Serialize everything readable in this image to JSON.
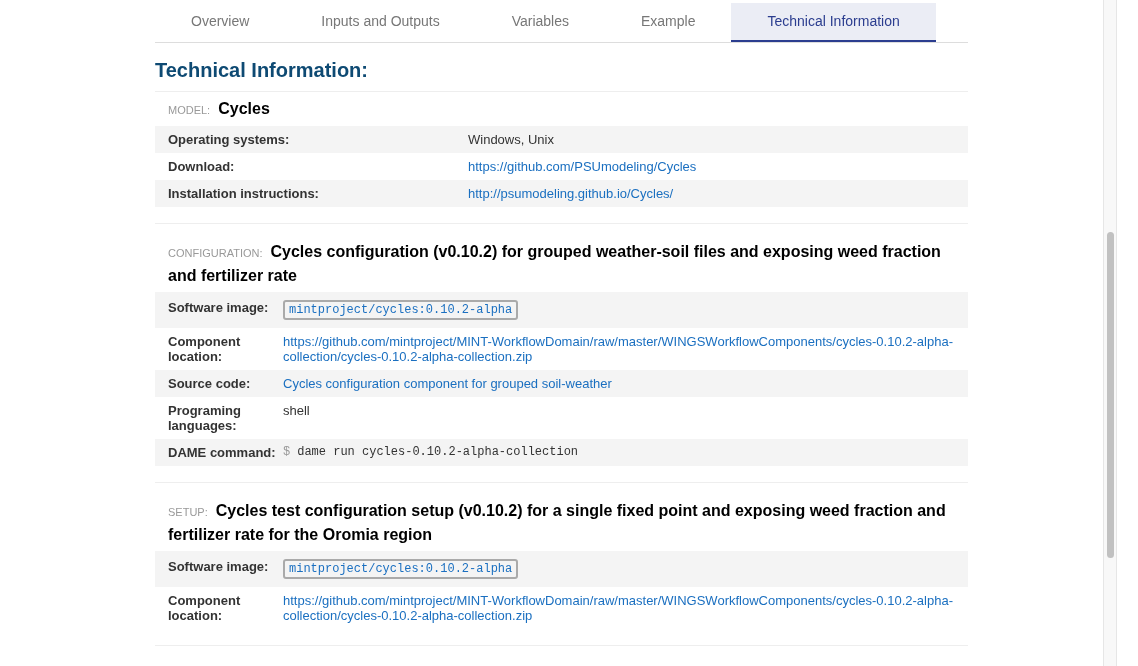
{
  "tabs": [
    {
      "label": "Overview",
      "selected": false
    },
    {
      "label": "Inputs and Outputs",
      "selected": false
    },
    {
      "label": "Variables",
      "selected": false
    },
    {
      "label": "Example",
      "selected": false
    },
    {
      "label": "Technical Information",
      "selected": true
    }
  ],
  "heading": "Technical Information:",
  "sections": [
    {
      "kind": "model",
      "label": "MODEL:",
      "name": "Cycles",
      "rows": [
        {
          "kind": "text",
          "label": "Operating systems:",
          "value": "Windows, Unix"
        },
        {
          "kind": "link",
          "label": "Download:",
          "value": "https://github.com/PSUmodeling/Cycles"
        },
        {
          "kind": "link",
          "label": "Installation instructions:",
          "value": "http://psumodeling.github.io/Cycles/"
        }
      ]
    },
    {
      "kind": "configuration",
      "label": "CONFIGURATION:",
      "name": "Cycles configuration (v0.10.2) for grouped weather-soil files and exposing weed fraction and fertilizer rate",
      "rows": [
        {
          "kind": "image",
          "label": "Software image:",
          "value": "mintproject/cycles:0.10.2-alpha"
        },
        {
          "kind": "link",
          "label": "Component location:",
          "value": "https://github.com/mintproject/MINT-WorkflowDomain/raw/master/WINGSWorkflowComponents/cycles-0.10.2-alpha-collection/cycles-0.10.2-alpha-collection.zip"
        },
        {
          "kind": "link",
          "label": "Source code:",
          "value": "Cycles configuration component for grouped soil-weather"
        },
        {
          "kind": "text",
          "label": "Programing languages:",
          "value": "shell"
        },
        {
          "kind": "command",
          "label": "DAME command:",
          "prompt": "$",
          "value": "dame run cycles-0.10.2-alpha-collection"
        }
      ]
    },
    {
      "kind": "setup",
      "label": "SETUP:",
      "name": "Cycles test configuration setup (v0.10.2) for a single fixed point and exposing weed fraction and fertilizer rate for the Oromia region",
      "rows": [
        {
          "kind": "image",
          "label": "Software image:",
          "value": "mintproject/cycles:0.10.2-alpha"
        },
        {
          "kind": "link",
          "label": "Component location:",
          "value": "https://github.com/mintproject/MINT-WorkflowDomain/raw/master/WINGSWorkflowComponents/cycles-0.10.2-alpha-collection/cycles-0.10.2-alpha-collection.zip"
        }
      ]
    }
  ]
}
